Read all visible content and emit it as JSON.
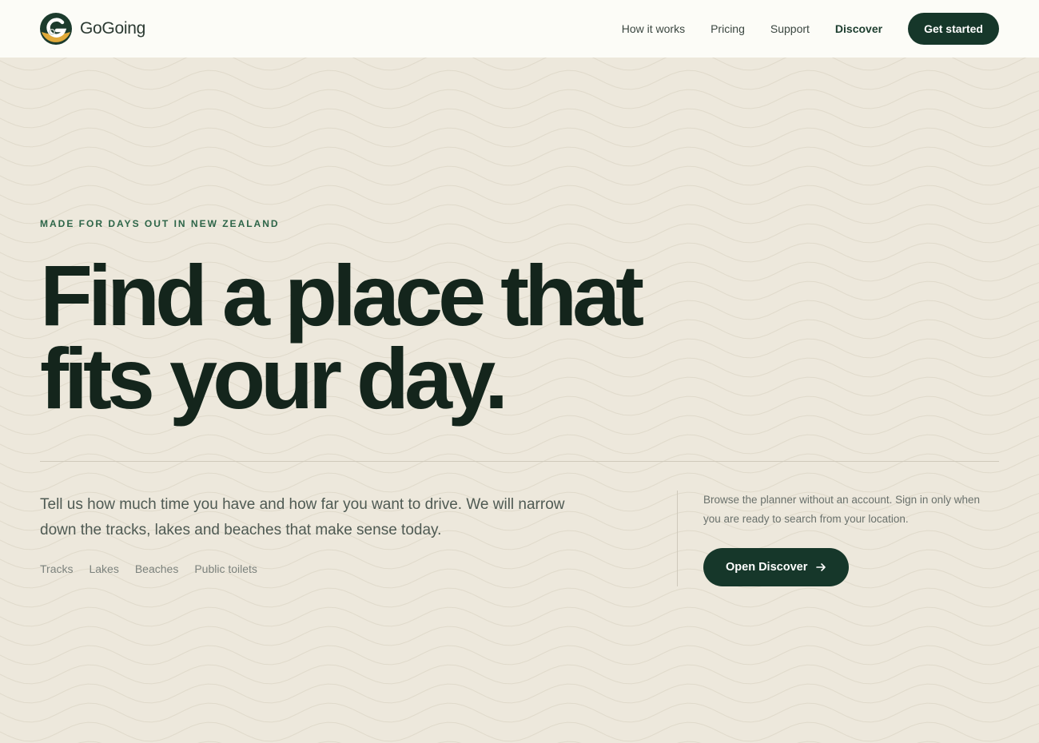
{
  "header": {
    "brand_name": "GoGoing",
    "nav": [
      {
        "label": "How it works"
      },
      {
        "label": "Pricing"
      },
      {
        "label": "Support"
      },
      {
        "label": "Discover"
      }
    ],
    "cta_label": "Get started"
  },
  "hero": {
    "eyebrow": "MADE FOR DAYS OUT IN NEW ZEALAND",
    "headline_line1": "Find a place that",
    "headline_line2": "fits your day.",
    "lead": "Tell us how much time you have and how far you want to drive. We will narrow down the tracks, lakes and beaches that make sense today.",
    "tags": [
      "Tracks",
      "Lakes",
      "Beaches",
      "Public toilets"
    ],
    "side_note": "Browse the planner without an account. Sign in only when you are ready to search from your location.",
    "cta_label": "Open Discover"
  },
  "icons": {
    "logo": "gogoing-logo-icon",
    "cta_arrow": "arrow-right-icon"
  },
  "colors": {
    "background": "#ede8dc",
    "header_bg": "#fcfcf7",
    "primary_dark": "#16372a",
    "accent_green": "#2d6548",
    "logo_gold": "#e0a93a",
    "headline": "#14251c"
  }
}
